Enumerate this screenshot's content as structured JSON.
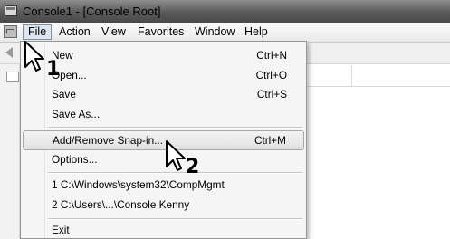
{
  "window": {
    "title": "Console1 - [Console Root]"
  },
  "menubar": {
    "items": [
      "File",
      "Action",
      "View",
      "Favorites",
      "Window",
      "Help"
    ]
  },
  "file_menu": {
    "new": {
      "label": "New",
      "shortcut": "Ctrl+N"
    },
    "open": {
      "label": "Open...",
      "shortcut": "Ctrl+O"
    },
    "save": {
      "label": "Save",
      "shortcut": "Ctrl+S"
    },
    "save_as": {
      "label": "Save As..."
    },
    "add_remove": {
      "label": "Add/Remove Snap-in...",
      "shortcut": "Ctrl+M"
    },
    "options": {
      "label": "Options..."
    },
    "recent1": {
      "label": "1 C:\\Windows\\system32\\CompMgmt"
    },
    "recent2": {
      "label": "2 C:\\Users\\...\\Console Kenny"
    },
    "exit": {
      "label": "Exit"
    }
  },
  "annotations": {
    "step1": "1",
    "step2": "2"
  }
}
